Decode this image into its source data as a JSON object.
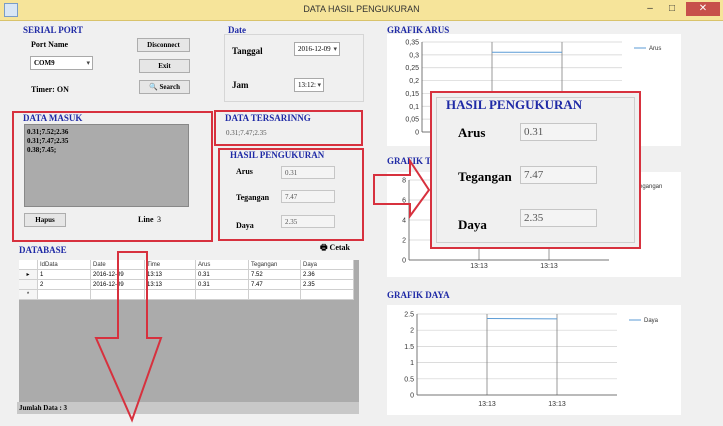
{
  "window": {
    "title": "DATA HASIL PENGUKURAN",
    "minimize": "–",
    "maximize": "□",
    "close": "✕"
  },
  "serial": {
    "heading": "SERIAL PORT",
    "port_name_label": "Port Name",
    "port_value": "COM9",
    "disconnect": "Disconnect",
    "exit": "Exit",
    "search": "Search",
    "timer_label": "Timer: ON"
  },
  "date": {
    "heading": "Date",
    "tanggal_label": "Tanggal",
    "tanggal_value": "2016-12-09",
    "jam_label": "Jam",
    "jam_value": "13:12:"
  },
  "masuk": {
    "heading": "DATA MASUK",
    "lines": [
      "0.31;7.52;2.36",
      "0.31;7.47;2.35",
      "0.38;7.45;"
    ],
    "hapus": "Hapus",
    "line_label": "Line",
    "line_value": "3"
  },
  "tersaring": {
    "heading": "DATA TERSARINNG",
    "value": "0.31;7.47;2.35"
  },
  "hasil": {
    "heading": "HASIL PENGUKURAN",
    "arus_label": "Arus",
    "arus": "0.31",
    "tegangan_label": "Tegangan",
    "tegangan": "7.47",
    "daya_label": "Daya",
    "daya": "2.35"
  },
  "database": {
    "heading": "DATABASE",
    "cetak": "Cetak",
    "columns": [
      "IdData",
      "Date",
      "Time",
      "Arus",
      "Tegangan",
      "Daya"
    ],
    "rows": [
      [
        "1",
        "2016-12-09",
        "13:13",
        "0.31",
        "7.52",
        "2.36"
      ],
      [
        "2",
        "2016-12-09",
        "13:13",
        "0.31",
        "7.47",
        "2.35"
      ]
    ],
    "row_markers": [
      "▸",
      "",
      "*"
    ],
    "jumlah": "Jumlah Data : 3"
  },
  "chart_titles": {
    "arus": "GRAFIK ARUS",
    "tegangan": "GRAFIK TEGANGAN",
    "daya": "GRAFIK DAYA"
  },
  "chart_data": [
    {
      "type": "line",
      "title": "GRAFIK ARUS",
      "x": [
        "13:13",
        "13:13"
      ],
      "series": [
        {
          "name": "Arus",
          "values": [
            0.31,
            0.31
          ]
        }
      ],
      "ylim": [
        0,
        0.35
      ],
      "yticks": [
        "0",
        "0,05",
        "0,1",
        "0,15",
        "0,2",
        "0,25",
        "0,3",
        "0,35"
      ],
      "legend": "top-right",
      "color": "#5b9bd5"
    },
    {
      "type": "line",
      "title": "GRAFIK TEGANGAN",
      "x": [
        "13:13",
        "13:13"
      ],
      "series": [
        {
          "name": "Tegangan",
          "values": [
            7.52,
            7.47
          ]
        }
      ],
      "ylim": [
        0,
        8
      ],
      "yticks": [
        "0",
        "2",
        "4",
        "6",
        "8"
      ],
      "xticks": [
        "13:13",
        "13:13"
      ],
      "legend": "top-right",
      "color": "#5b9bd5"
    },
    {
      "type": "line",
      "title": "GRAFIK DAYA",
      "x": [
        "13:13",
        "13:13"
      ],
      "series": [
        {
          "name": "Daya",
          "values": [
            2.36,
            2.35
          ]
        }
      ],
      "ylim": [
        0,
        2.5
      ],
      "yticks": [
        "0",
        "0.5",
        "1",
        "1.5",
        "2",
        "2.5"
      ],
      "xticks": [
        "13:13",
        "13:13"
      ],
      "legend": "top-right",
      "color": "#5b9bd5"
    }
  ],
  "popup": {
    "heading": "HASIL PENGUKURAN",
    "arus_label": "Arus",
    "arus": "0.31",
    "tegangan_label": "Tegangan",
    "tegangan": "7.47",
    "daya_label": "Daya",
    "daya": "2.35"
  }
}
